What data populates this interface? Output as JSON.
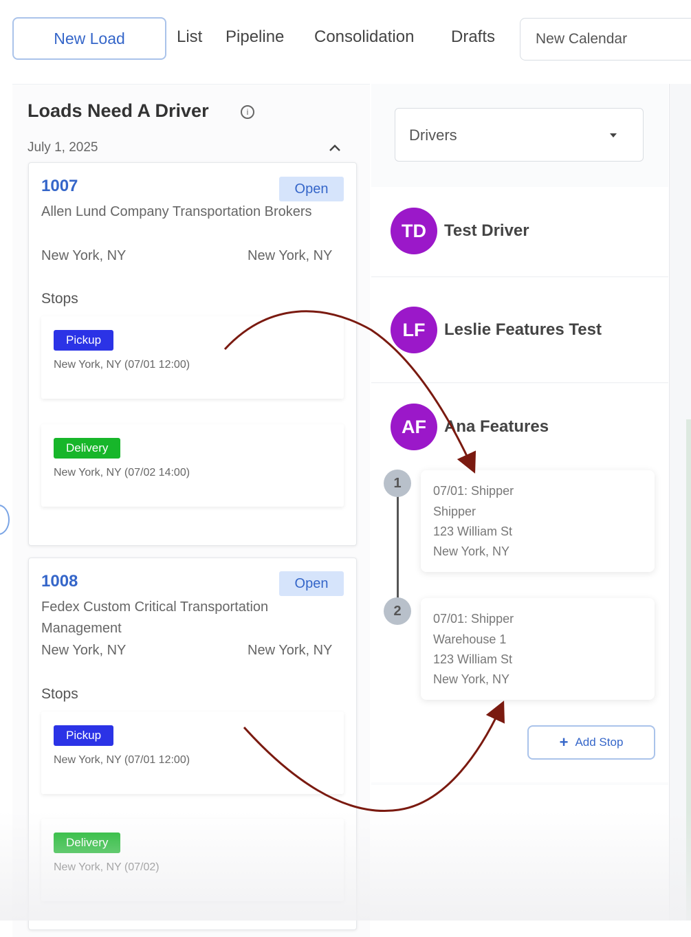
{
  "nav": {
    "new_load": "New Load",
    "tabs": [
      "List",
      "Pipeline",
      "Consolidation",
      "Drafts"
    ],
    "calendar_placeholder": "New Calendar"
  },
  "left_panel": {
    "title": "Loads Need A Driver",
    "date": "July 1, 2025",
    "loads": [
      {
        "id": "1007",
        "status": "Open",
        "company": "Allen Lund Company Transportation Brokers",
        "origin": "New York, NY",
        "destination": "New York, NY",
        "stops_label": "Stops",
        "stops": [
          {
            "type": "Pickup",
            "detail": "New York, NY (07/01 12:00)"
          },
          {
            "type": "Delivery",
            "detail": "New York, NY (07/02 14:00)"
          }
        ]
      },
      {
        "id": "1008",
        "status": "Open",
        "company": "Fedex Custom Critical Transportation Management",
        "origin": "New York, NY",
        "destination": "New York, NY",
        "stops_label": "Stops",
        "stops": [
          {
            "type": "Pickup",
            "detail": "New York, NY (07/01 12:00)"
          },
          {
            "type": "Delivery",
            "detail": "New York, NY (07/02)"
          }
        ]
      }
    ]
  },
  "drivers_panel": {
    "select_label": "Drivers",
    "drivers": [
      {
        "initials": "TD",
        "name": "Test Driver"
      },
      {
        "initials": "LF",
        "name": "Leslie Features Test"
      },
      {
        "initials": "AF",
        "name": "Ana Features"
      }
    ],
    "route_stops": [
      {
        "number": "1",
        "lines": [
          "07/01: Shipper",
          "Shipper",
          "123 William St",
          "New York, NY"
        ]
      },
      {
        "number": "2",
        "lines": [
          "07/01: Shipper",
          "Warehouse 1",
          "123 William St",
          "New York, NY"
        ]
      }
    ],
    "add_stop": "Add Stop"
  },
  "colors": {
    "accent_blue": "#3566c9",
    "avatar_purple": "#9b18c9",
    "pickup_tag": "#2b33e6",
    "delivery_tag": "#17b62a",
    "arrow": "#7a1a10"
  },
  "icons": {
    "info": "info-icon",
    "collapse": "chevron-up-icon",
    "dropdown": "caret-down-icon",
    "add": "plus-icon"
  }
}
